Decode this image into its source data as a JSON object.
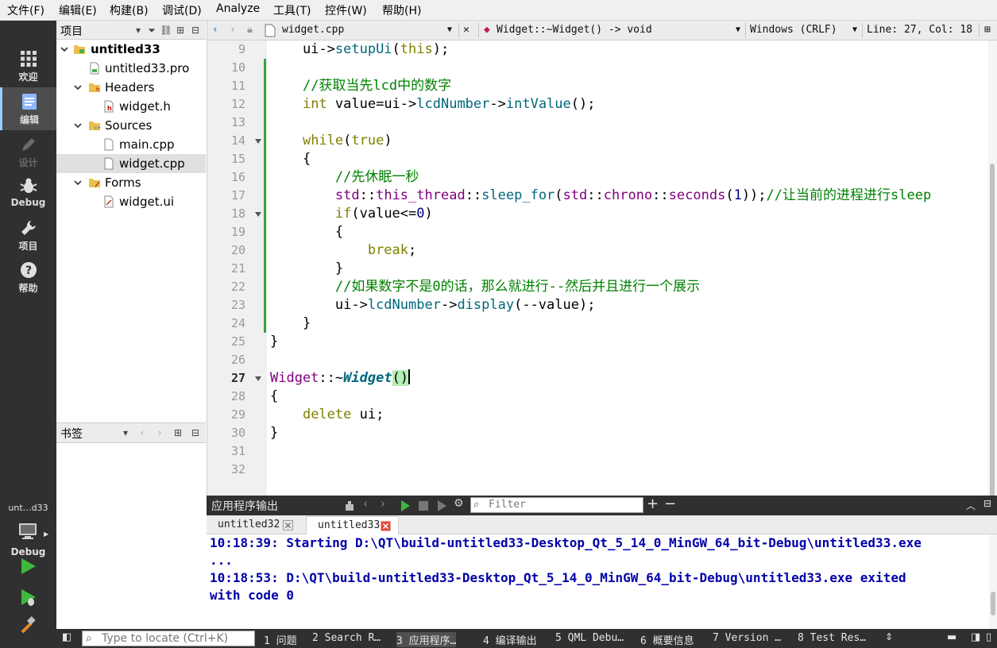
{
  "menu": [
    "文件(F)",
    "编辑(E)",
    "构建(B)",
    "调试(D)",
    "Analyze",
    "工具(T)",
    "控件(W)",
    "帮助(H)"
  ],
  "modes": [
    {
      "label": "欢迎",
      "icon": "grid-icon",
      "state": "normal"
    },
    {
      "label": "编辑",
      "icon": "document-icon",
      "state": "active"
    },
    {
      "label": "设计",
      "icon": "pencil-icon",
      "state": "disabled"
    },
    {
      "label": "Debug",
      "icon": "bug-icon",
      "state": "normal"
    },
    {
      "label": "项目",
      "icon": "wrench-icon",
      "state": "normal"
    },
    {
      "label": "帮助",
      "icon": "help-icon",
      "state": "normal"
    }
  ],
  "kit": {
    "name": "unt…d33",
    "mode": "Debug"
  },
  "project_pane": {
    "title": "项目",
    "tree": [
      {
        "label": "untitled33",
        "level": 0,
        "expanded": true,
        "icon": "project-folder-icon",
        "bold": true
      },
      {
        "label": "untitled33.pro",
        "level": 1,
        "icon": "pro-file-icon"
      },
      {
        "label": "Headers",
        "level": 1,
        "expanded": true,
        "icon": "headers-folder-icon"
      },
      {
        "label": "widget.h",
        "level": 2,
        "icon": "header-file-icon"
      },
      {
        "label": "Sources",
        "level": 1,
        "expanded": true,
        "icon": "sources-folder-icon"
      },
      {
        "label": "main.cpp",
        "level": 2,
        "icon": "cpp-file-icon"
      },
      {
        "label": "widget.cpp",
        "level": 2,
        "icon": "cpp-file-icon",
        "selected": true
      },
      {
        "label": "Forms",
        "level": 1,
        "expanded": true,
        "icon": "forms-folder-icon"
      },
      {
        "label": "widget.ui",
        "level": 2,
        "icon": "ui-file-icon"
      }
    ]
  },
  "bookmarks_pane": {
    "title": "书签"
  },
  "editor": {
    "file_name": "widget.cpp",
    "symbol": "Widget::~Widget() -> void",
    "line_ending": "Windows (CRLF)",
    "position": "Line: 27, Col: 18",
    "current_line": "27",
    "lines": [
      {
        "n": "9",
        "tokens": [
          {
            "t": "    ui->"
          },
          {
            "t": "setupUi",
            "c": "fn"
          },
          {
            "t": "("
          },
          {
            "t": "this",
            "c": "kw"
          },
          {
            "t": ");"
          }
        ]
      },
      {
        "n": "10",
        "tokens": []
      },
      {
        "n": "11",
        "tokens": [
          {
            "t": "    "
          },
          {
            "t": "//获取当先lcd中的数字",
            "c": "cm"
          }
        ]
      },
      {
        "n": "12",
        "tokens": [
          {
            "t": "    "
          },
          {
            "t": "int",
            "c": "kw"
          },
          {
            "t": " value=ui->"
          },
          {
            "t": "lcdNumber",
            "c": "fn"
          },
          {
            "t": "->"
          },
          {
            "t": "intValue",
            "c": "fn"
          },
          {
            "t": "();"
          }
        ]
      },
      {
        "n": "13",
        "tokens": []
      },
      {
        "n": "14",
        "fold": true,
        "tokens": [
          {
            "t": "    "
          },
          {
            "t": "while",
            "c": "kw"
          },
          {
            "t": "("
          },
          {
            "t": "true",
            "c": "kw"
          },
          {
            "t": ")"
          }
        ]
      },
      {
        "n": "15",
        "tokens": [
          {
            "t": "    {"
          }
        ]
      },
      {
        "n": "16",
        "tokens": [
          {
            "t": "        "
          },
          {
            "t": "//先休眠一秒",
            "c": "cm"
          }
        ]
      },
      {
        "n": "17",
        "tokens": [
          {
            "t": "        "
          },
          {
            "t": "std",
            "c": "ty"
          },
          {
            "t": "::"
          },
          {
            "t": "this_thread",
            "c": "ty"
          },
          {
            "t": "::"
          },
          {
            "t": "sleep_for",
            "c": "fn"
          },
          {
            "t": "("
          },
          {
            "t": "std",
            "c": "ty"
          },
          {
            "t": "::"
          },
          {
            "t": "chrono",
            "c": "ty"
          },
          {
            "t": "::"
          },
          {
            "t": "seconds",
            "c": "ty"
          },
          {
            "t": "("
          },
          {
            "t": "1",
            "c": "nm"
          },
          {
            "t": "));"
          },
          {
            "t": "//让当前的进程进行sleep",
            "c": "cm"
          }
        ]
      },
      {
        "n": "18",
        "fold": true,
        "tokens": [
          {
            "t": "        "
          },
          {
            "t": "if",
            "c": "kw"
          },
          {
            "t": "(value<="
          },
          {
            "t": "0",
            "c": "nm"
          },
          {
            "t": ")"
          }
        ]
      },
      {
        "n": "19",
        "tokens": [
          {
            "t": "        {"
          }
        ]
      },
      {
        "n": "20",
        "tokens": [
          {
            "t": "            "
          },
          {
            "t": "break",
            "c": "kw"
          },
          {
            "t": ";"
          }
        ]
      },
      {
        "n": "21",
        "tokens": [
          {
            "t": "        }"
          }
        ]
      },
      {
        "n": "22",
        "tokens": [
          {
            "t": "        "
          },
          {
            "t": "//如果数字不是0的话，那么就进行--然后并且进行一个展示",
            "c": "cm"
          }
        ]
      },
      {
        "n": "23",
        "tokens": [
          {
            "t": "        ui->"
          },
          {
            "t": "lcdNumber",
            "c": "fn"
          },
          {
            "t": "->"
          },
          {
            "t": "display",
            "c": "fn"
          },
          {
            "t": "(--value);"
          }
        ]
      },
      {
        "n": "24",
        "tokens": [
          {
            "t": "    }"
          }
        ]
      },
      {
        "n": "25",
        "tokens": [
          {
            "t": "}"
          }
        ]
      },
      {
        "n": "26",
        "tokens": []
      },
      {
        "n": "27",
        "fold": true,
        "tokens": [
          {
            "t": "Widget",
            "c": "ty"
          },
          {
            "t": "::~"
          },
          {
            "t": "Widget",
            "c": "dtor"
          },
          {
            "t": "()",
            "c": "paren"
          },
          {
            "t": "",
            "c": "caret"
          }
        ]
      },
      {
        "n": "28",
        "tokens": [
          {
            "t": "{"
          }
        ]
      },
      {
        "n": "29",
        "tokens": [
          {
            "t": "    "
          },
          {
            "t": "delete",
            "c": "kw"
          },
          {
            "t": " ui;"
          }
        ]
      },
      {
        "n": "30",
        "tokens": [
          {
            "t": "}"
          }
        ]
      },
      {
        "n": "31",
        "tokens": []
      },
      {
        "n": "32",
        "tokens": []
      }
    ]
  },
  "output_pane": {
    "title": "应用程序输出",
    "filter_placeholder": "Filter",
    "tabs": [
      {
        "label": "untitled32",
        "active": false
      },
      {
        "label": "untitled33",
        "active": true
      }
    ],
    "lines": [
      "10:18:39: Starting D:\\QT\\build-untitled33-Desktop_Qt_5_14_0_MinGW_64_bit-Debug\\untitled33.exe",
      "...",
      "10:18:53: D:\\QT\\build-untitled33-Desktop_Qt_5_14_0_MinGW_64_bit-Debug\\untitled33.exe exited",
      "with code 0"
    ],
    "text_color": "#0000aa"
  },
  "statusbar": {
    "locator_placeholder": "Type to locate (Ctrl+K)",
    "tabs": [
      "1 问题",
      "2 Search R…",
      "3 应用程序…",
      "4 编译输出",
      "5 QML Debu…",
      "6 概要信息",
      "7 Version …",
      "8 Test Res…"
    ],
    "active_tab": 2
  },
  "colors": {
    "keyword": "#808000",
    "function": "#00677c",
    "type": "#800080",
    "comment": "#008000",
    "number": "#000080",
    "sidebar": "#303030",
    "change_marker": "#3ca03c"
  }
}
